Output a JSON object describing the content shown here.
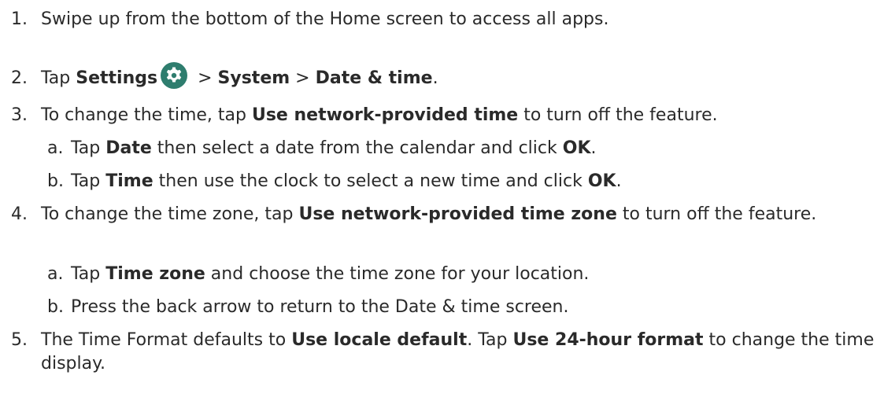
{
  "steps": [
    {
      "num": "1.",
      "text": "Swipe up from the bottom of the Home screen to access all apps."
    },
    {
      "num": "2.",
      "pre": "Tap ",
      "b1": "Settings",
      "sep1": " > ",
      "b2": "System",
      "sep2": " > ",
      "b3": "Date & time",
      "end": ".",
      "icon": "settings-gear-icon",
      "icon_color": "#2e7d6e"
    },
    {
      "num": "3.",
      "pre": "To change the time, tap ",
      "b1": "Use network-provided time",
      "post": " to turn off the feature.",
      "subs": [
        {
          "num": "a.",
          "pre": "Tap ",
          "b1": "Date",
          "mid": " then select a date from the calendar and click ",
          "b2": "OK",
          "end": "."
        },
        {
          "num": "b.",
          "pre": "Tap ",
          "b1": "Time",
          "mid": " then use the clock to select a new time and click ",
          "b2": "OK",
          "end": "."
        }
      ]
    },
    {
      "num": "4.",
      "pre": "To change the time zone, tap ",
      "b1": "Use network-provided time zone",
      "post": " to turn off the feature.",
      "subs": [
        {
          "num": "a.",
          "pre": "Tap ",
          "b1": "Time zone",
          "post": " and choose the time zone for your location."
        },
        {
          "num": "b.",
          "text": "Press the back arrow to return to the Date & time screen."
        }
      ]
    },
    {
      "num": "5.",
      "pre": "The Time Format defaults to ",
      "b1": "Use locale default",
      "mid": ". Tap ",
      "b2": "Use 24-hour format",
      "post": " to change the time display."
    }
  ]
}
